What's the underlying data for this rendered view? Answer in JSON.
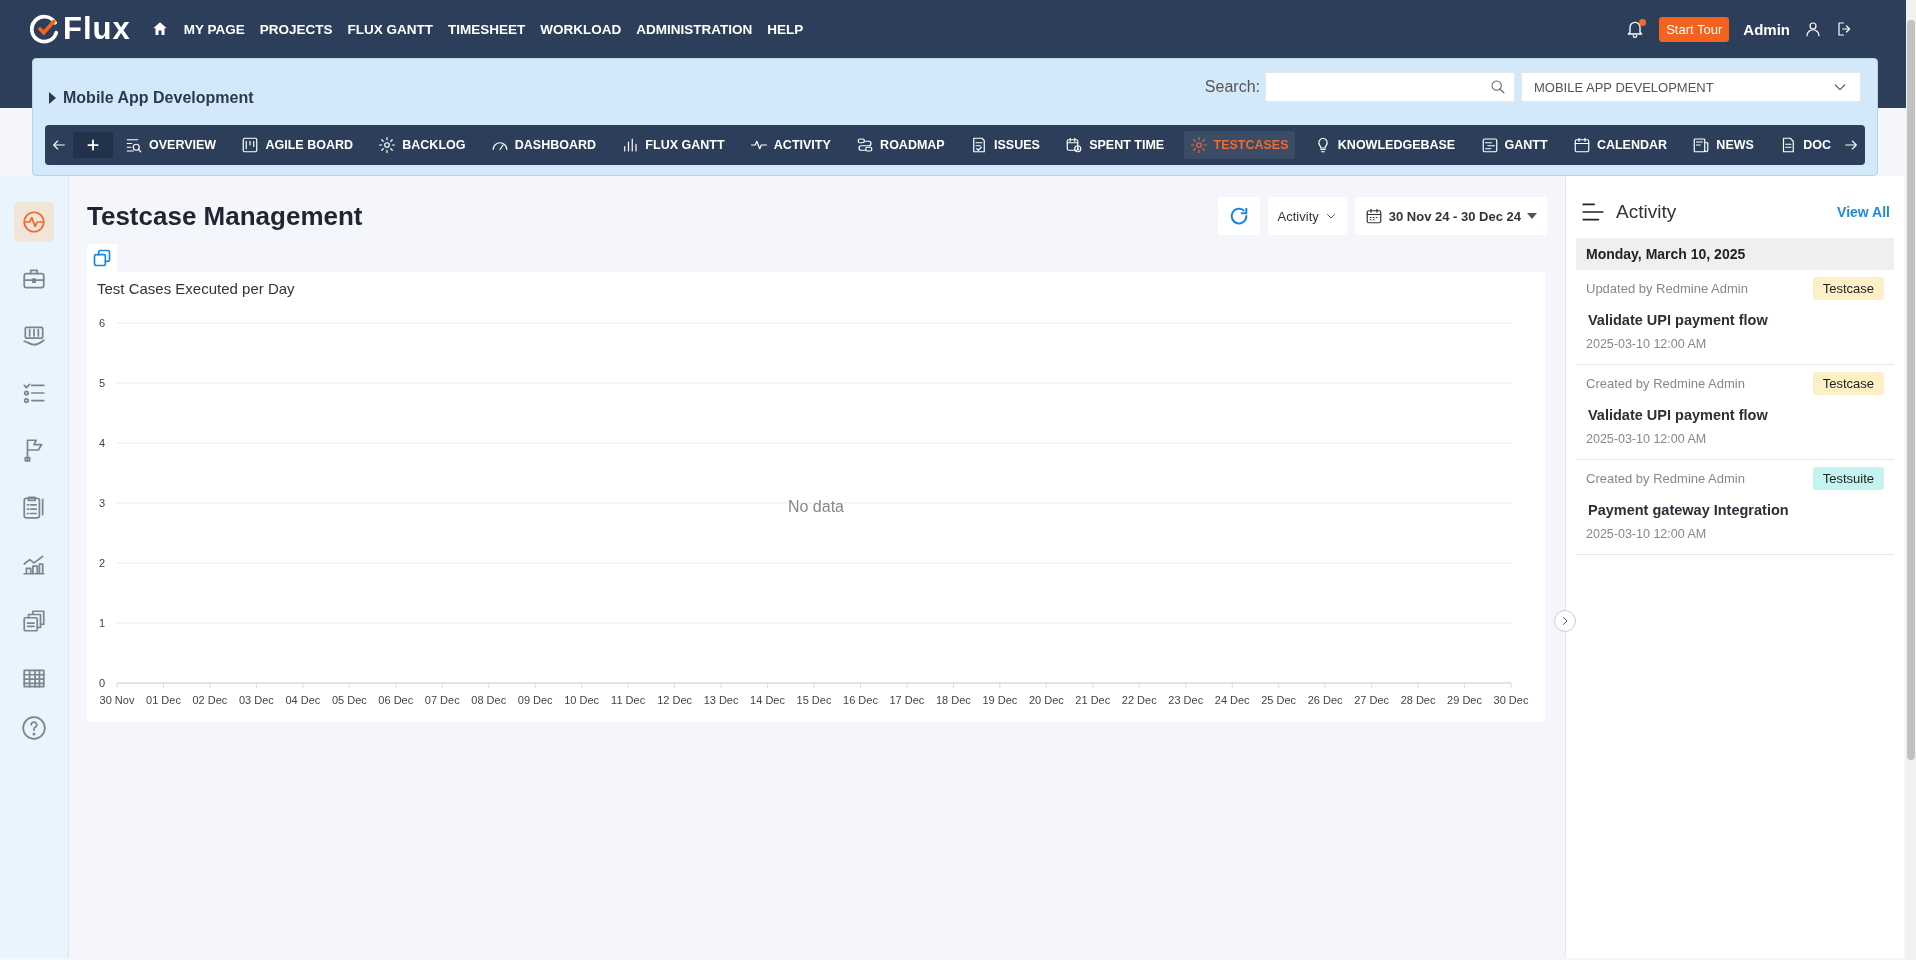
{
  "header": {
    "logo_text": "Flux",
    "menu": [
      "MY PAGE",
      "PROJECTS",
      "FLUX GANTT",
      "TIMESHEET",
      "WORKLOAD",
      "ADMINISTRATION",
      "HELP"
    ],
    "notifications_unread": true,
    "tour_button": "Start Tour",
    "user": "Admin"
  },
  "project_bar": {
    "project": "Mobile App Development",
    "search_label": "Search:",
    "project_select": "MOBILE APP DEVELOPMENT",
    "tabs": [
      {
        "label": "OVERVIEW",
        "selected": false
      },
      {
        "label": "AGILE BOARD",
        "selected": false
      },
      {
        "label": "BACKLOG",
        "selected": false
      },
      {
        "label": "DASHBOARD",
        "selected": false
      },
      {
        "label": "FLUX GANTT",
        "selected": false
      },
      {
        "label": "ACTIVITY",
        "selected": false
      },
      {
        "label": "ROADMAP",
        "selected": false
      },
      {
        "label": "ISSUES",
        "selected": false
      },
      {
        "label": "SPENT TIME",
        "selected": false
      },
      {
        "label": "TESTCASES",
        "selected": true
      },
      {
        "label": "KNOWLEDGEBASE",
        "selected": false
      },
      {
        "label": "GANTT",
        "selected": false
      },
      {
        "label": "CALENDAR",
        "selected": false
      },
      {
        "label": "NEWS",
        "selected": false
      },
      {
        "label": "DOC",
        "selected": false
      }
    ]
  },
  "sidebar": {
    "items": [
      {
        "selected": true
      },
      {
        "selected": false
      },
      {
        "selected": false
      },
      {
        "selected": false
      },
      {
        "selected": false
      },
      {
        "selected": false
      },
      {
        "selected": false
      },
      {
        "selected": false
      },
      {
        "selected": false
      }
    ]
  },
  "main": {
    "title": "Testcase Management",
    "filter": "Activity",
    "date_range": "30 Nov 24 - 30 Dec 24",
    "chart": {
      "no_data_text": "No data",
      "chart_data": {
        "type": "line",
        "title": "Test Cases Executed per Day",
        "categories": [
          "30 Nov",
          "01 Dec",
          "02 Dec",
          "03 Dec",
          "04 Dec",
          "05 Dec",
          "06 Dec",
          "07 Dec",
          "08 Dec",
          "09 Dec",
          "10 Dec",
          "11 Dec",
          "12 Dec",
          "13 Dec",
          "14 Dec",
          "15 Dec",
          "16 Dec",
          "17 Dec",
          "18 Dec",
          "19 Dec",
          "20 Dec",
          "21 Dec",
          "22 Dec",
          "23 Dec",
          "24 Dec",
          "25 Dec",
          "26 Dec",
          "27 Dec",
          "28 Dec",
          "29 Dec",
          "30 Dec"
        ],
        "ylim": [
          0,
          6
        ],
        "yticks": [
          0,
          1,
          2,
          3,
          4,
          5,
          6
        ],
        "grid": true
      }
    }
  },
  "activity_panel": {
    "title": "Activity",
    "view_all": "View All",
    "date": "Monday, March 10, 2025",
    "items": [
      {
        "action": "Updated by Redmine Admin",
        "tag": "Testcase",
        "color": "#fdf0c6",
        "title": "Validate UPI payment flow",
        "time": "2025-03-10 12:00 AM"
      },
      {
        "action": "Created by Redmine Admin",
        "tag": "Testcase",
        "color": "#fdf0c6",
        "title": "Validate UPI payment flow",
        "time": "2025-03-10 12:00 AM"
      },
      {
        "action": "Created by Redmine Admin",
        "tag": "Testsuite",
        "color": "#c4f4ef",
        "title": "Payment gateway Integration",
        "time": "2025-03-10 12:00 AM"
      }
    ]
  }
}
